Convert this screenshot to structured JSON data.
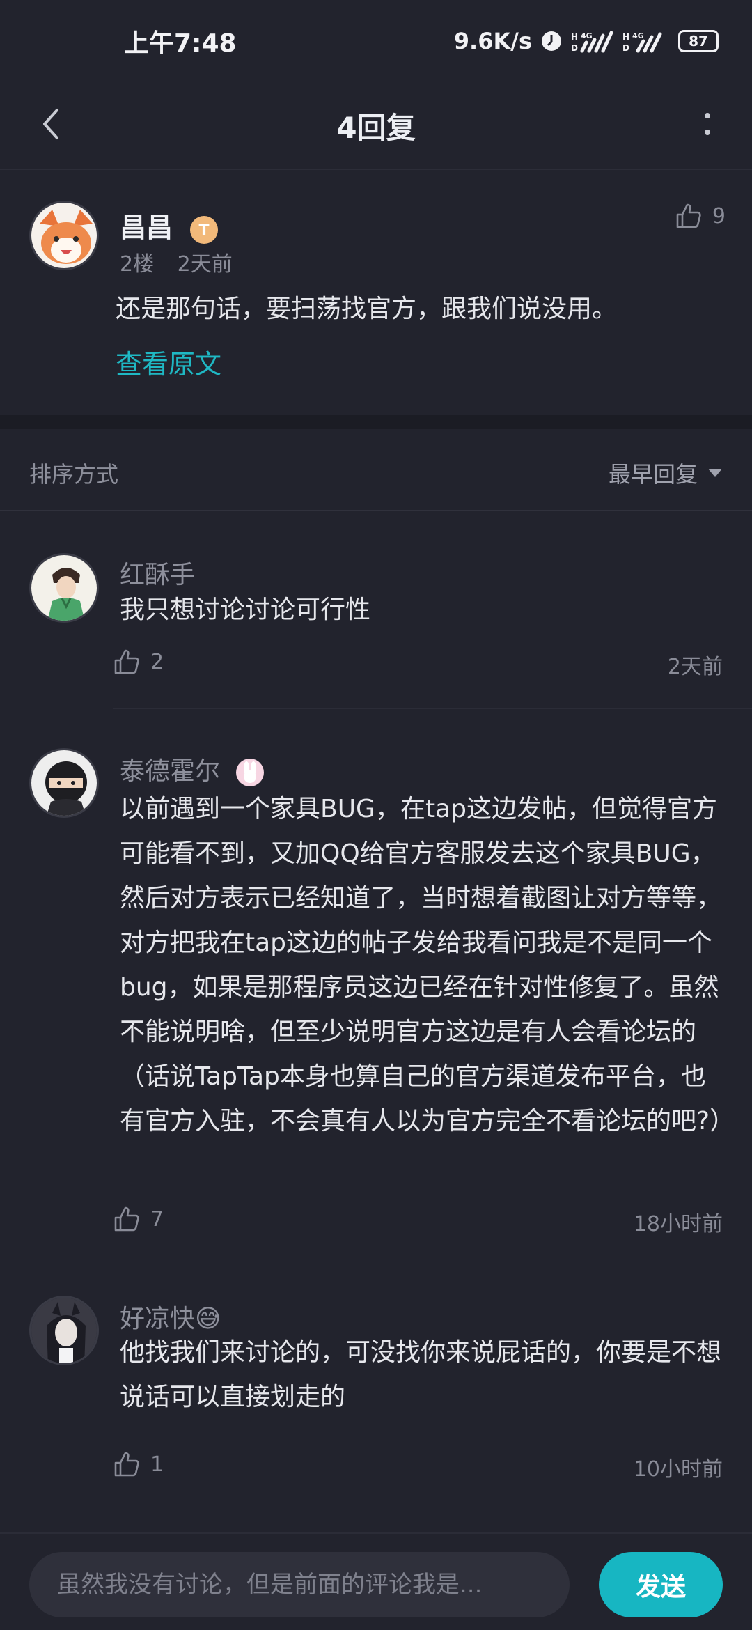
{
  "status_bar": {
    "time": "上午7:48",
    "speed": "9.6K/s",
    "battery": "87"
  },
  "header": {
    "title": "4回复"
  },
  "main_post": {
    "author": "昌昌",
    "floor": "2楼",
    "time": "2天前",
    "likes": "9",
    "text": "还是那句话，要扫荡找官方，跟我们说没用。",
    "view_original": "查看原文"
  },
  "sort": {
    "label": "排序方式",
    "selected": "最早回复"
  },
  "replies": [
    {
      "author": "红酥手",
      "text": "我只想讨论讨论可行性",
      "likes": "2",
      "time": "2天前"
    },
    {
      "author": "泰德霍尔",
      "text": "以前遇到一个家具BUG，在tap这边发帖，但觉得官方可能看不到，又加QQ给官方客服发去这个家具BUG，然后对方表示已经知道了，当时想着截图让对方等等，对方把我在tap这边的帖子发给我看问我是不是同一个bug，如果是那程序员这边已经在针对性修复了。虽然不能说明啥，但至少说明官方这边是有人会看论坛的（话说TapTap本身也算自己的官方渠道发布平台，也有官方入驻，不会真有人以为官方完全不看论坛的吧?）",
      "likes": "7",
      "time": "18小时前"
    },
    {
      "author": "好凉快😅",
      "text": "他找我们来讨论的，可没找你来说屁话的，你要是不想说话可以直接划走的",
      "likes": "1",
      "time": "10小时前"
    }
  ],
  "composer": {
    "placeholder": "虽然我没有讨论，但是前面的评论我是...",
    "send_label": "发送"
  },
  "colors": {
    "background": "#22232d",
    "accent": "#17b6c2",
    "link": "#1fb8c4"
  }
}
